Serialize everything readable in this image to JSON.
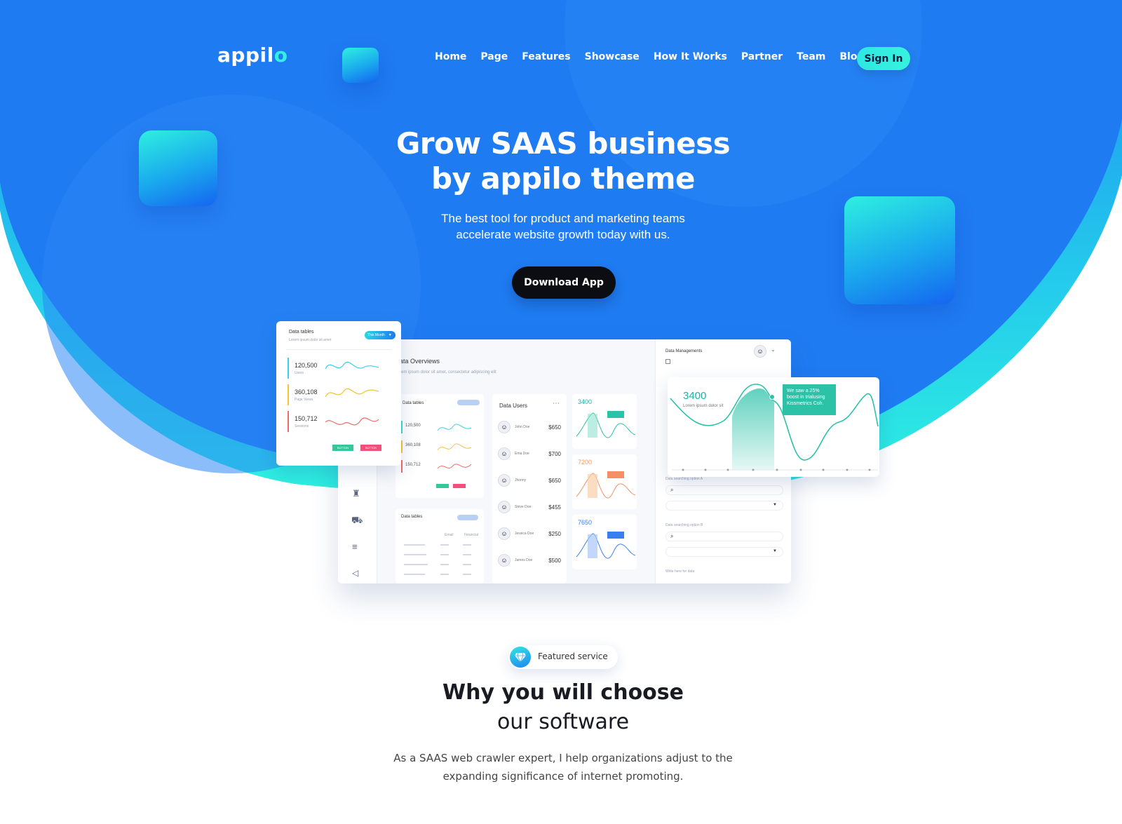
{
  "colors": {
    "hero_blue": "#1f7bf2",
    "hero_cyan": "#2ef0e0",
    "button_dark": "#0c0d12",
    "text_dark": "#1a1b22"
  },
  "nav": {
    "logo_main": "appil",
    "logo_accent": "o",
    "links": [
      "Home",
      "Page",
      "Features",
      "Showcase",
      "How It Works",
      "Partner",
      "Team",
      "Blog"
    ],
    "signin_label": "Sign In"
  },
  "hero": {
    "headline_line1": "Grow SAAS business",
    "headline_line2": "by appilo theme",
    "sub_line1": "The best tool for product and marketing teams",
    "sub_line2": "accelerate website growth today with us.",
    "cta_label": "Download App"
  },
  "mockup": {
    "overview_title": "ata Overviews",
    "overview_sub": "rem ipsum dolor sit amet, consectetur adipiscing elit",
    "data_tables_card": {
      "title": "Data tables",
      "sub": "Lorem ipsum dolor sit amet",
      "pill": "This Month",
      "stats": [
        {
          "value": "120,500",
          "label": "Users",
          "color": "#3ad1e6"
        },
        {
          "value": "360,108",
          "label": "Page Views",
          "color": "#f5c233"
        },
        {
          "value": "150,712",
          "label": "Sessions",
          "color": "#f06a6a"
        }
      ],
      "btn1": "BUTTON",
      "btn2": "BUTTON"
    },
    "inner_tables": {
      "title": "Data tables",
      "stats": [
        "120,500",
        "360,108",
        "150,712"
      ]
    },
    "data_users": {
      "title": "Data Users",
      "rows": [
        {
          "name": "John Doe",
          "amount": "$650"
        },
        {
          "name": "Ema Doe",
          "amount": "$700"
        },
        {
          "name": "Jhonny",
          "amount": "$650"
        },
        {
          "name": "Steve Doe",
          "amount": "$455"
        },
        {
          "name": "Jessica Doe",
          "amount": "$250"
        },
        {
          "name": "James Doe",
          "amount": "$500"
        }
      ]
    },
    "mini_charts": [
      "3400",
      "7200",
      "7650"
    ],
    "data_management": {
      "title": "Data Managements",
      "search1_label": "Data searching option A",
      "search2_label": "Data searching option B",
      "write_label": "Write here for data"
    },
    "big_chart": {
      "value": "3400",
      "caption": "Lorem ipsum dolor sit",
      "tooltip": "We saw a 25% boost in trialusing Kissmetrics Coh."
    },
    "table_card": {
      "title": "Data tables",
      "col1": "Email",
      "col2": "Financial"
    }
  },
  "featured": {
    "badge_label": "Featured service",
    "title_line1": "Why you will choose",
    "title_line2": "our software",
    "para_line1": "As a SAAS web crawler expert, I help organizations adjust to the",
    "para_line2": "expanding significance of internet promoting."
  }
}
